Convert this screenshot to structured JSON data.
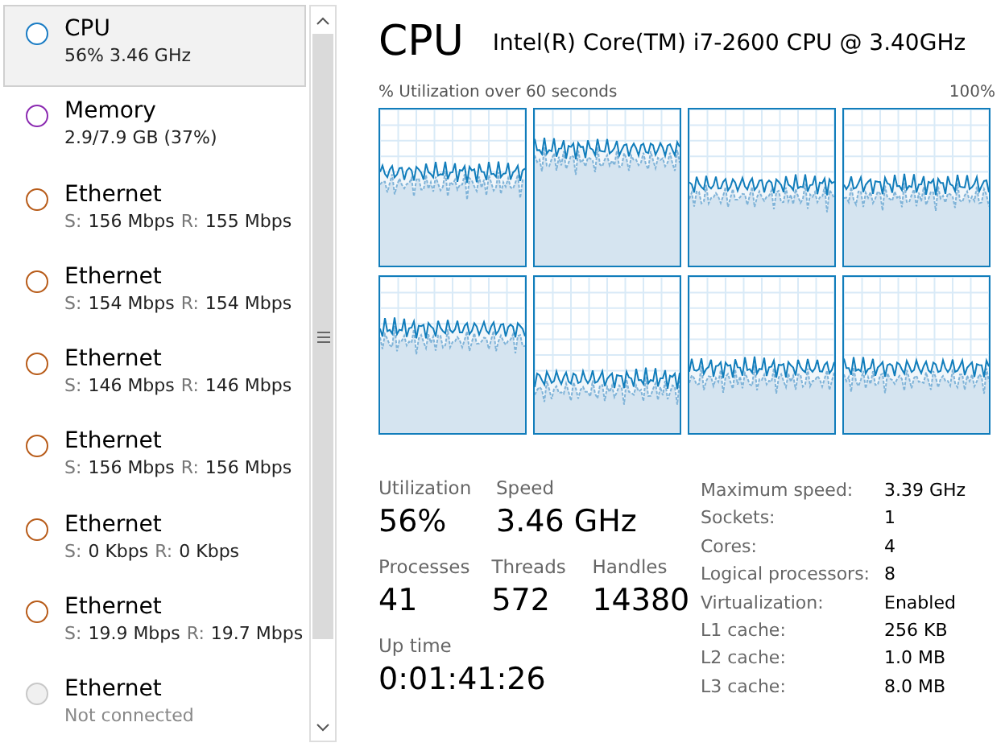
{
  "sidebar": {
    "items": [
      {
        "name": "CPU",
        "kind": "plain",
        "detail": "56% 3.46 GHz",
        "color": "#1a7cc4",
        "selected": true
      },
      {
        "name": "Memory",
        "kind": "plain",
        "detail": "2.9/7.9 GB (37%)",
        "color": "#8b2ab1",
        "selected": false
      },
      {
        "name": "Ethernet",
        "kind": "network",
        "send_label": "S:",
        "send": "156 Mbps",
        "recv_label": "R:",
        "recv": "155 Mbps",
        "color": "#b85c1a",
        "selected": false
      },
      {
        "name": "Ethernet",
        "kind": "network",
        "send_label": "S:",
        "send": "154 Mbps",
        "recv_label": "R:",
        "recv": "154 Mbps",
        "color": "#b85c1a",
        "selected": false
      },
      {
        "name": "Ethernet",
        "kind": "network",
        "send_label": "S:",
        "send": "146 Mbps",
        "recv_label": "R:",
        "recv": "146 Mbps",
        "color": "#b85c1a",
        "selected": false
      },
      {
        "name": "Ethernet",
        "kind": "network",
        "send_label": "S:",
        "send": "156 Mbps",
        "recv_label": "R:",
        "recv": "156 Mbps",
        "color": "#b85c1a",
        "selected": false
      },
      {
        "name": "Ethernet",
        "kind": "network",
        "send_label": "S:",
        "send": "0 Kbps",
        "recv_label": "R:",
        "recv": "0 Kbps",
        "color": "#b85c1a",
        "selected": false
      },
      {
        "name": "Ethernet",
        "kind": "network",
        "send_label": "S:",
        "send": "19.9 Mbps",
        "recv_label": "R:",
        "recv": "19.7 Mbps",
        "color": "#b85c1a",
        "selected": false
      },
      {
        "name": "Ethernet",
        "kind": "offline",
        "detail": "Not connected",
        "color": "#c8c8c8",
        "selected": false
      }
    ]
  },
  "header": {
    "title": "CPU",
    "model": "Intel(R) Core(TM) i7-2600 CPU @ 3.40GHz"
  },
  "graph_caption": "% Utilization over 60 seconds",
  "graph_max": "100%",
  "stats": [
    {
      "label": "Utilization",
      "value": "56%"
    },
    {
      "label": "Speed",
      "value": "3.46 GHz"
    },
    {
      "label": "Processes",
      "value": "41"
    },
    {
      "label": "Threads",
      "value": "572"
    },
    {
      "label": "Handles",
      "value": "14380"
    },
    {
      "label": "Up time",
      "value": "0:01:41:26"
    }
  ],
  "details": [
    {
      "label": "Maximum speed:",
      "value": "3.39 GHz"
    },
    {
      "label": "Sockets:",
      "value": "1"
    },
    {
      "label": "Cores:",
      "value": "4"
    },
    {
      "label": "Logical processors:",
      "value": "8"
    },
    {
      "label": "Virtualization:",
      "value": "Enabled"
    },
    {
      "label": "L1 cache:",
      "value": "256 KB"
    },
    {
      "label": "L2 cache:",
      "value": "1.0 MB"
    },
    {
      "label": "L3 cache:",
      "value": "8.0 MB"
    }
  ]
}
